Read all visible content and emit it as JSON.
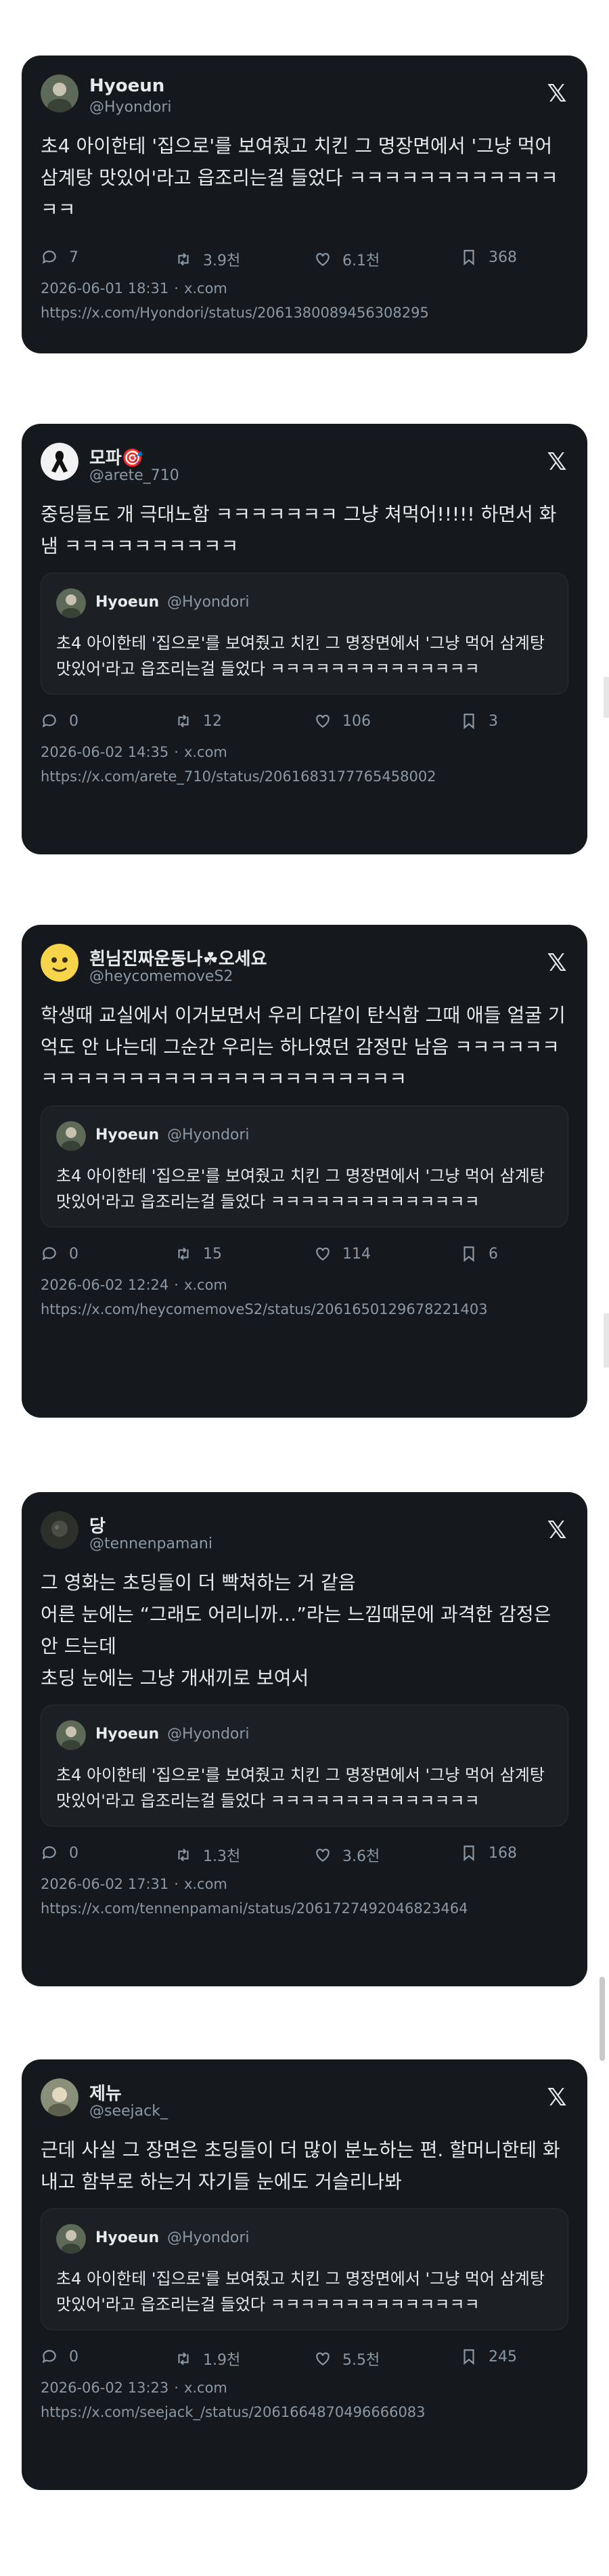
{
  "quoted": {
    "name": "Hyoeun",
    "handle": "@Hyondori",
    "text": "초4 아이한테 '집으로'를 보여줬고 치킨 그 명장면에서 '그냥 먹어 삼계탕 맛있어'라고 읍조리는걸 들었다 ㅋㅋㅋㅋㅋㅋㅋㅋㅋㅋㅋㅋㅋㅋ"
  },
  "posts": [
    {
      "name": "Hyoeun",
      "handle": "@Hyondori",
      "text": "초4 아이한테 '집으로'를 보여줬고 치킨 그 명장면에서 '그냥 먹어 삼계탕 맛있어'라고 읍조리는걸 들었다 ㅋㅋㅋㅋㅋㅋㅋㅋㅋㅋㅋㅋㅋㅋ",
      "replies": "7",
      "reposts": "3.9천",
      "likes": "6.1천",
      "bookmarks": "368",
      "datetime": "2026-06-01 18:31",
      "source": "x.com",
      "url": "https://x.com/Hyondori/status/2061380089456308295"
    },
    {
      "name": "모파🎯",
      "handle": "@arete_710",
      "text": "중딩들도 개 극대노함 ㅋㅋㅋㅋㅋㅋㅋ 그냥 쳐먹어!!!!! 하면서 화냄 ㅋㅋㅋㅋㅋㅋㅋㅋㅋㅋ",
      "replies": "0",
      "reposts": "12",
      "likes": "106",
      "bookmarks": "3",
      "datetime": "2026-06-02 14:35",
      "source": "x.com",
      "url": "https://x.com/arete_710/status/2061683177765458002"
    },
    {
      "name": "흰님진짜운동나☘오세요",
      "handle": "@heycomemoveS2",
      "text": "학생때 교실에서 이거보면서 우리 다같이 탄식함 그때 애들 얼굴 기억도 안 나는데 그순간 우리는 하나였던 감정만 남음 ㅋㅋㅋㅋㅋㅋㅋㅋㅋㅋㅋㅋㅋㅋㅋㅋㅋㅋㅋㅋㅋㅋㅋㅋㅋㅋㅋ",
      "replies": "0",
      "reposts": "15",
      "likes": "114",
      "bookmarks": "6",
      "datetime": "2026-06-02 12:24",
      "source": "x.com",
      "url": "https://x.com/heycomemoveS2/status/2061650129678221403"
    },
    {
      "name": "당",
      "handle": "@tennenpamani",
      "text": "그 영화는 초딩들이 더 빡쳐하는 거 같음\n어른 눈에는 “그래도 어리니까…”라는 느낌때문에 과격한 감정은 안 드는데\n초딩 눈에는 그냥 개새끼로 보여서",
      "replies": "0",
      "reposts": "1.3천",
      "likes": "3.6천",
      "bookmarks": "168",
      "datetime": "2026-06-02 17:31",
      "source": "x.com",
      "url": "https://x.com/tennenpamani/status/2061727492046823464"
    },
    {
      "name": "제뉴",
      "handle": "@seejack_",
      "text": "근데 사실 그 장면은 초딩들이 더 많이 분노하는 편. 할머니한테 화내고 함부로 하는거 자기들 눈에도 거슬리나봐",
      "replies": "0",
      "reposts": "1.9천",
      "likes": "5.5천",
      "bookmarks": "245",
      "datetime": "2026-06-02 13:23",
      "source": "x.com",
      "url": "https://x.com/seejack_/status/2061664870496666083"
    }
  ],
  "colors": {
    "card_bg": "#15181c",
    "quote_bg": "#1c1f24",
    "text": "#e7e9ea",
    "muted": "#8b98a5",
    "page_bg": "#ffffff"
  },
  "icons": [
    "reply-icon",
    "repost-icon",
    "like-icon",
    "bookmark-icon",
    "x-logo-icon"
  ]
}
